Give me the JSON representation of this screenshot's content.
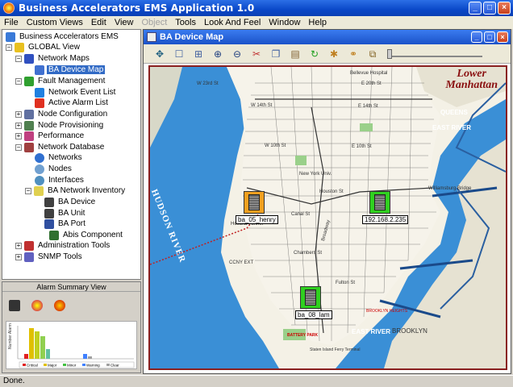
{
  "app": {
    "title": "Business Accelerators EMS Application 1.0"
  },
  "window_controls": {
    "minimize": "_",
    "maximize": "□",
    "close": "×"
  },
  "menu": [
    "File",
    "Custom Views",
    "Edit",
    "View",
    "Object",
    "Tools",
    "Look And Feel",
    "Window",
    "Help"
  ],
  "menu_disabled": [
    "Object"
  ],
  "tree": {
    "root": "Business Accelerators EMS",
    "global_view": "GLOBAL View",
    "network_maps": "Network Maps",
    "ba_device_map": "BA Device Map",
    "fault_management": "Fault Management",
    "network_event_list": "Network Event List",
    "active_alarm_list": "Active Alarm List",
    "node_configuration": "Node Configuration",
    "node_provisioning": "Node Provisioning",
    "performance": "Performance",
    "network_database": "Network Database",
    "networks": "Networks",
    "nodes": "Nodes",
    "interfaces": "Interfaces",
    "ba_network_inventory": "BA Network Inventory",
    "ba_device": "BA Device",
    "ba_unit": "BA Unit",
    "ba_port": "BA Port",
    "abis_component": "Abis Component",
    "administration_tools": "Administration Tools",
    "snmp_tools": "SNMP Tools"
  },
  "alarm_summary": {
    "title": "Alarm Summary View",
    "ylabel": "Number Alarm",
    "categories": [
      "Critical",
      "Major",
      "Minor",
      "Warning",
      "Clear"
    ],
    "colors": {
      "critical": "#e02020",
      "major": "#e0c000",
      "minor": "#40c040",
      "warning": "#4080ff",
      "clear": "#a0a0a0"
    }
  },
  "map_window": {
    "title": "BA Device Map",
    "map_heading_line1": "Lower",
    "map_heading_line2": "Manhattan"
  },
  "map_labels": {
    "hudson_river": "HUDSON RIVER",
    "east_river_top": "EAST RIVER",
    "east_river_bottom": "EAST RIVER",
    "queens": "QUEENS",
    "brooklyn": "BROOKLYN",
    "battery_park": "BATTERY PARK",
    "williamsburg_bridge": "Williamsburg Bridge",
    "holland_tunnel": "Holland Tunnel",
    "w23": "W 23rd St",
    "w14": "W 14th St",
    "e14": "E 14th St",
    "e20": "E 20th St",
    "w10": "W 10th St",
    "e10": "E 10th St",
    "houston": "Houston St",
    "canal": "Canal St",
    "broadway": "Broadway",
    "chambers": "Chambers St",
    "fulton": "Fulton St",
    "ccny": "CCNY EXT",
    "new_york_univ": "New York Univ.",
    "bellevue": "Bellevue Hospital",
    "brooklyn_heights": "BROOKLYN HEIGHTS",
    "staten_island_ferry": "Staten Island Ferry Terminal"
  },
  "devices": [
    {
      "id": "ba_05_henry",
      "label": "ba_05_henry",
      "status": "major",
      "color": "#f0a020"
    },
    {
      "id": "dev_192",
      "label": "192.168.2.235",
      "status": "clear",
      "color": "#30d020"
    },
    {
      "id": "ba_08_lam",
      "label": "ba_08_lam",
      "status": "clear",
      "color": "#30d020"
    }
  ],
  "status": {
    "text": "Done."
  }
}
